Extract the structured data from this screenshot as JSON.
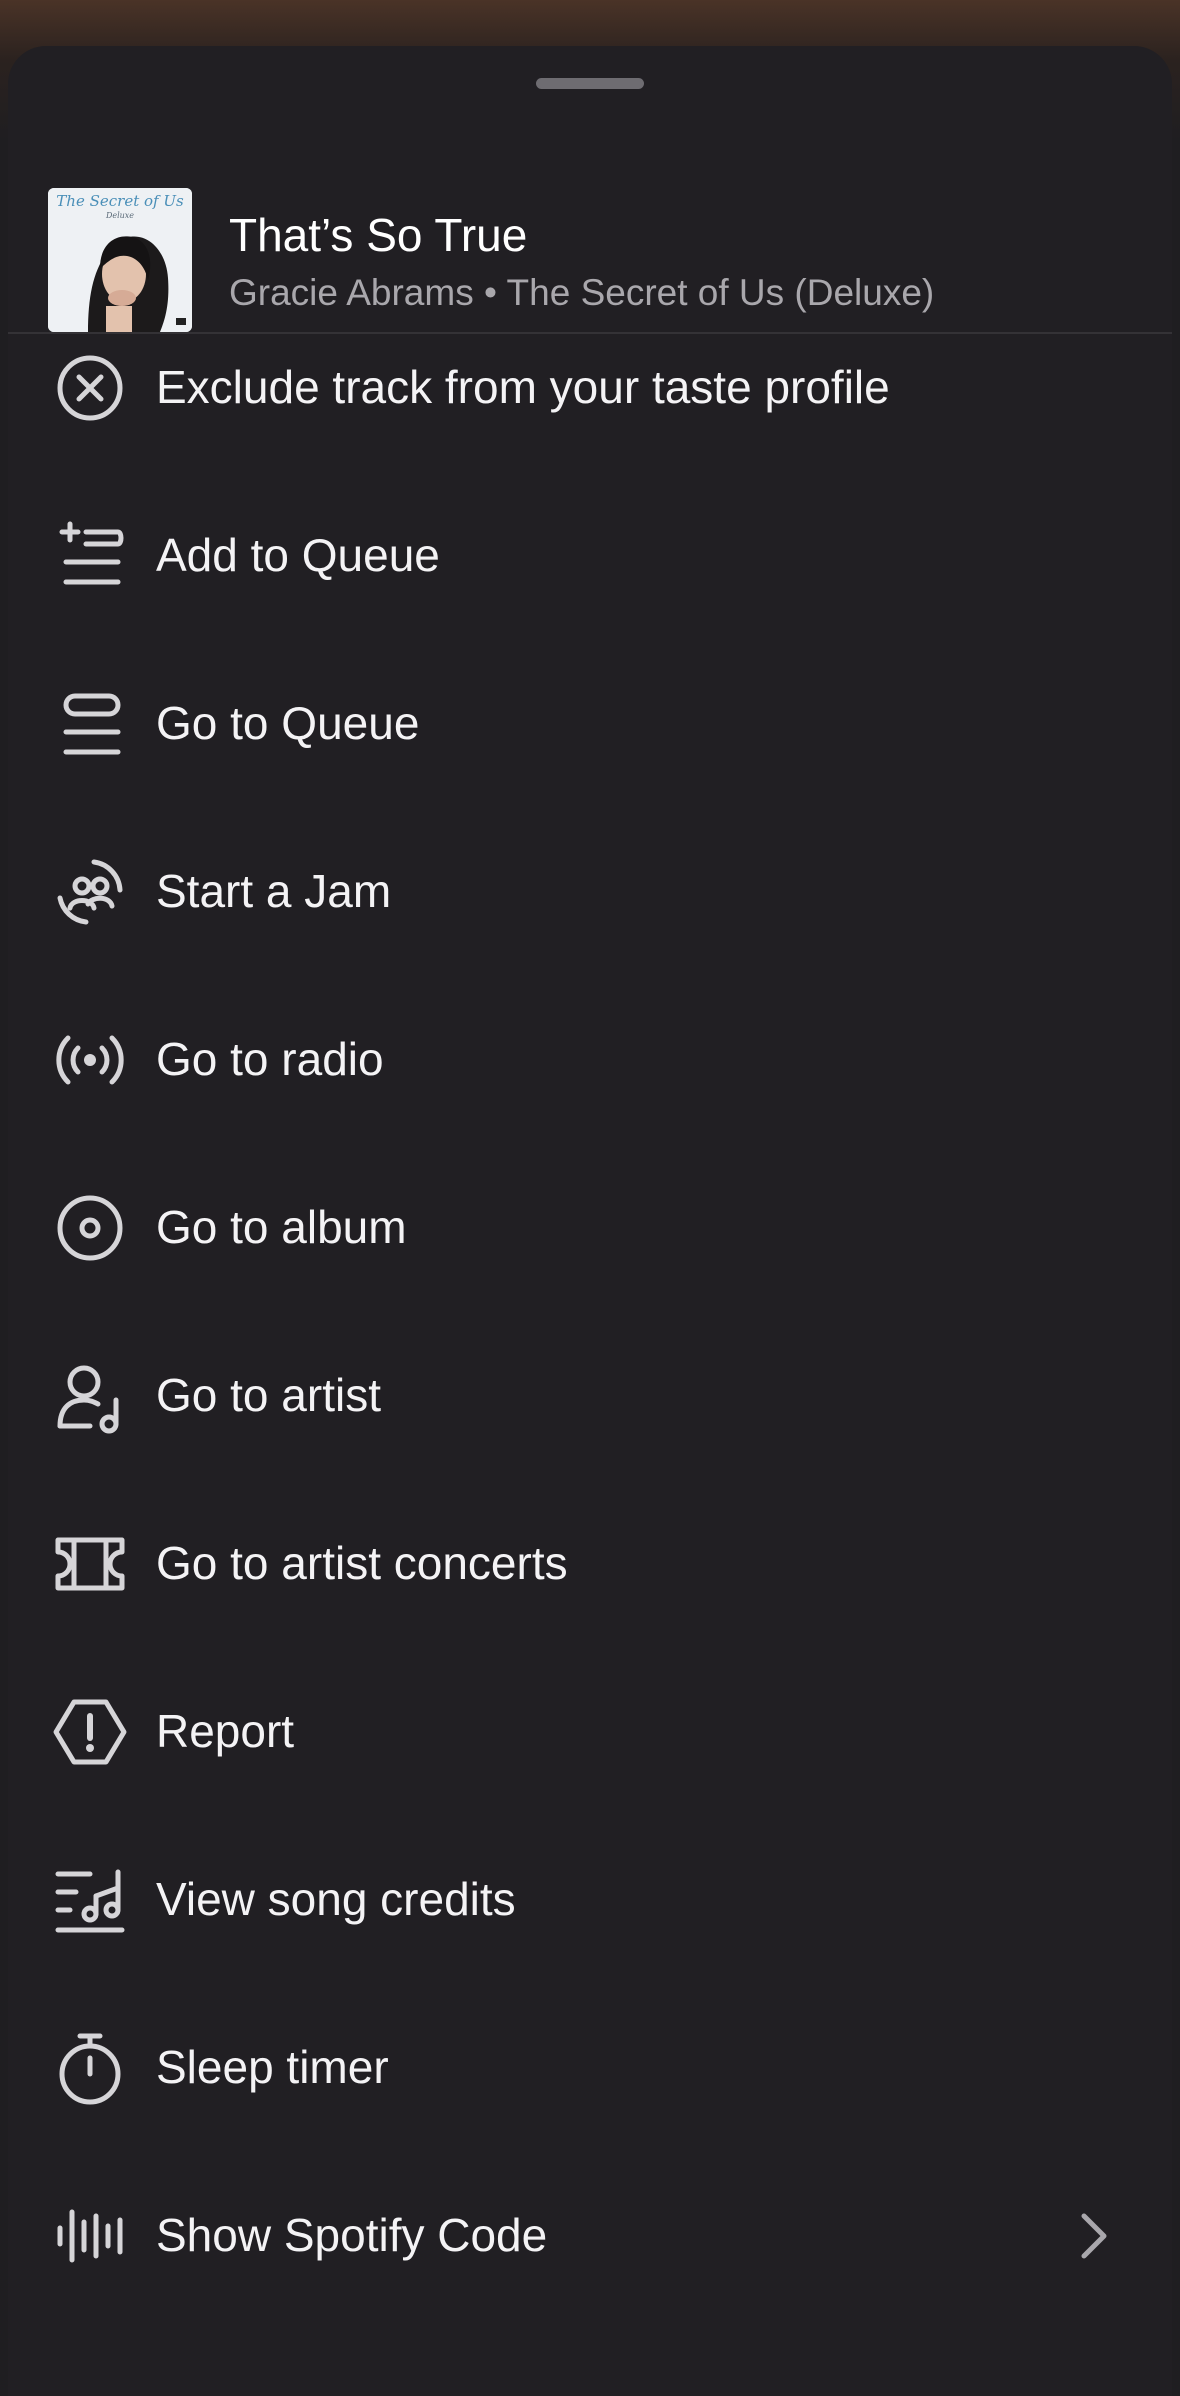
{
  "track": {
    "title": "That’s So True",
    "subtitle": "Gracie Abrams • The Secret of Us (Deluxe)",
    "album_art_text": "The Secret of Us",
    "album_art_subtext": "Deluxe"
  },
  "menu": {
    "items": [
      {
        "label": "Exclude track from your taste profile",
        "icon": "exclude-circle-x-icon"
      },
      {
        "label": "Add to Queue",
        "icon": "add-to-queue-icon"
      },
      {
        "label": "Go to Queue",
        "icon": "queue-list-icon"
      },
      {
        "label": "Start a Jam",
        "icon": "jam-people-icon"
      },
      {
        "label": "Go to radio",
        "icon": "radio-broadcast-icon"
      },
      {
        "label": "Go to album",
        "icon": "album-disc-icon"
      },
      {
        "label": "Go to artist",
        "icon": "artist-person-note-icon"
      },
      {
        "label": "Go to artist concerts",
        "icon": "ticket-icon"
      },
      {
        "label": "Report",
        "icon": "report-warning-icon"
      },
      {
        "label": "View song credits",
        "icon": "song-credits-icon"
      },
      {
        "label": "Sleep timer",
        "icon": "stopwatch-icon"
      },
      {
        "label": "Show Spotify Code",
        "icon": "spotify-code-waveform-icon"
      }
    ]
  },
  "colors": {
    "sheet_background": "#211f23",
    "text_primary": "#ffffff",
    "text_secondary": "#a9a7ac",
    "icon_color": "#d6d5d8"
  }
}
